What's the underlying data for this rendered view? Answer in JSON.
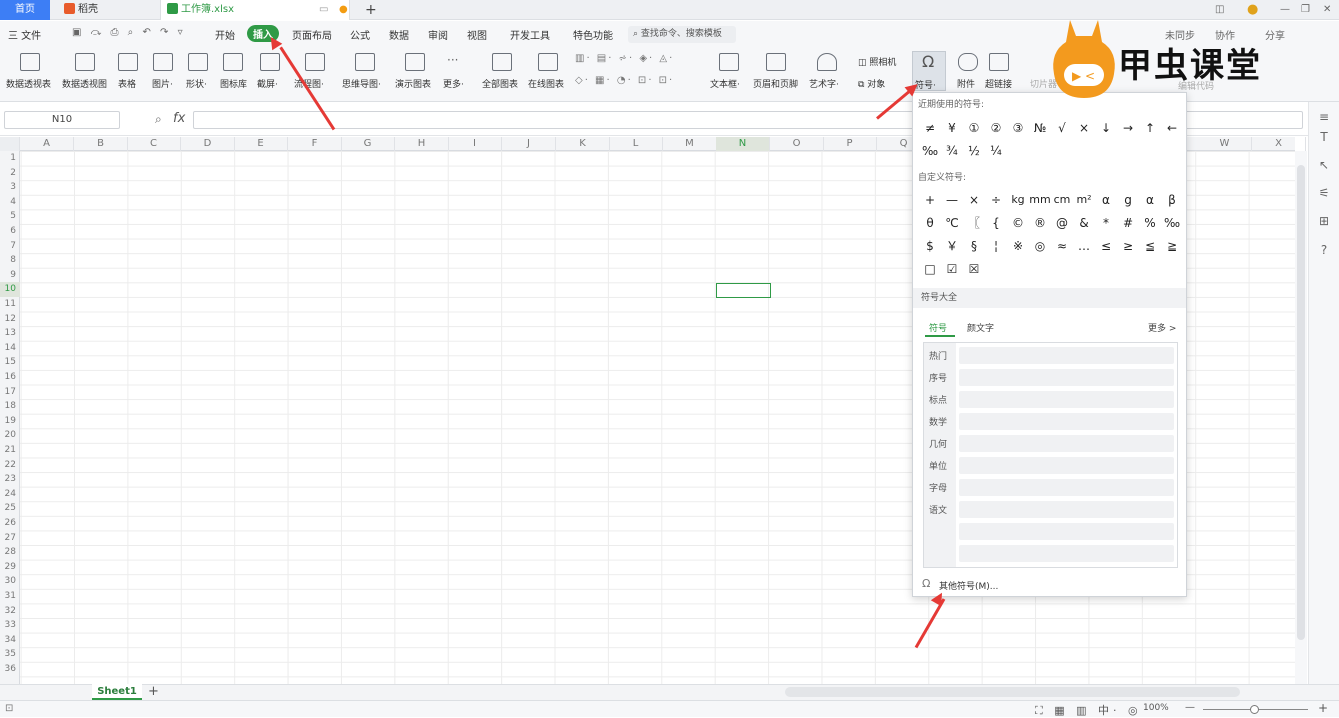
{
  "tabs": {
    "home": "首页",
    "daoke": "稻壳",
    "workbook": "工作簿.xlsx",
    "add": "+"
  },
  "menu": {
    "file": "三 文件",
    "start": "开始",
    "insert": "插入",
    "layout": "页面布局",
    "formula": "公式",
    "data": "数据",
    "review": "审阅",
    "view": "视图",
    "dev": "开发工具",
    "special": "特色功能",
    "search": "查找命令、搜索模板",
    "sync": "未同步",
    "collab": "协作",
    "share": "分享"
  },
  "ribbon": [
    "数据透视表",
    "数据透视图",
    "表格",
    "图片·",
    "形状·",
    "图标库",
    "截屏·",
    "流程图·",
    "思维导图·",
    "演示图表",
    "更多·",
    "全部图表",
    "在线图表",
    "文本框·",
    "页眉和页脚",
    "艺术字·",
    "照相机",
    "对象",
    "符号·",
    "附件",
    "超链接",
    "切片器",
    "编辑代码"
  ],
  "formula": {
    "cell": "N10",
    "fx": "fx"
  },
  "columns": [
    "A",
    "B",
    "C",
    "D",
    "E",
    "F",
    "G",
    "H",
    "I",
    "J",
    "K",
    "L",
    "M",
    "N",
    "O",
    "P",
    "Q",
    "W",
    "X"
  ],
  "rows": [
    "1",
    "2",
    "3",
    "4",
    "5",
    "6",
    "7",
    "8",
    "9",
    "10",
    "11",
    "12",
    "13",
    "14",
    "15",
    "16",
    "17",
    "18",
    "19",
    "20",
    "21",
    "22",
    "23",
    "24",
    "25",
    "26",
    "27",
    "28",
    "29",
    "30",
    "31",
    "32",
    "33",
    "34",
    "35",
    "36"
  ],
  "panel": {
    "recent_title": "近期使用的符号:",
    "recent_row1": [
      "≠",
      "¥",
      "①",
      "②",
      "③",
      "№",
      "√",
      "×",
      "↓",
      "→",
      "↑",
      "←"
    ],
    "recent_row2": [
      "‰",
      "¾",
      "½",
      "¼"
    ],
    "custom_title": "自定义符号:",
    "custom_row1": [
      "+",
      "—",
      "×",
      "÷",
      "kg",
      "mm",
      "cm",
      "m²",
      "α",
      "g",
      "α",
      "β"
    ],
    "custom_row2": [
      "θ",
      "℃",
      "〖",
      "{",
      "©",
      "®",
      "@",
      "&",
      "*",
      "#",
      "%",
      "‰"
    ],
    "custom_row3": [
      "$",
      "￥",
      "§",
      "¦",
      "※",
      "◎",
      "≈",
      "…",
      "≤",
      "≥",
      "≦",
      "≧"
    ],
    "custom_row4": [
      "□",
      "☑",
      "☒"
    ],
    "all_title": "符号大全",
    "sub_symbol": "符号",
    "sub_kaomoji": "颜文字",
    "more": "更多 >",
    "categories": [
      "热门",
      "序号",
      "标点",
      "数学",
      "几何",
      "单位",
      "字母",
      "语文"
    ],
    "other": "其他符号(M)..."
  },
  "sheet": {
    "name": "Sheet1",
    "add": "+"
  },
  "status": {
    "zoom": "100%"
  },
  "watermark": "甲虫课堂",
  "colors": {
    "accent": "#2f9a46",
    "tab_blue": "#3d7ef5",
    "arrow": "#e53935"
  }
}
